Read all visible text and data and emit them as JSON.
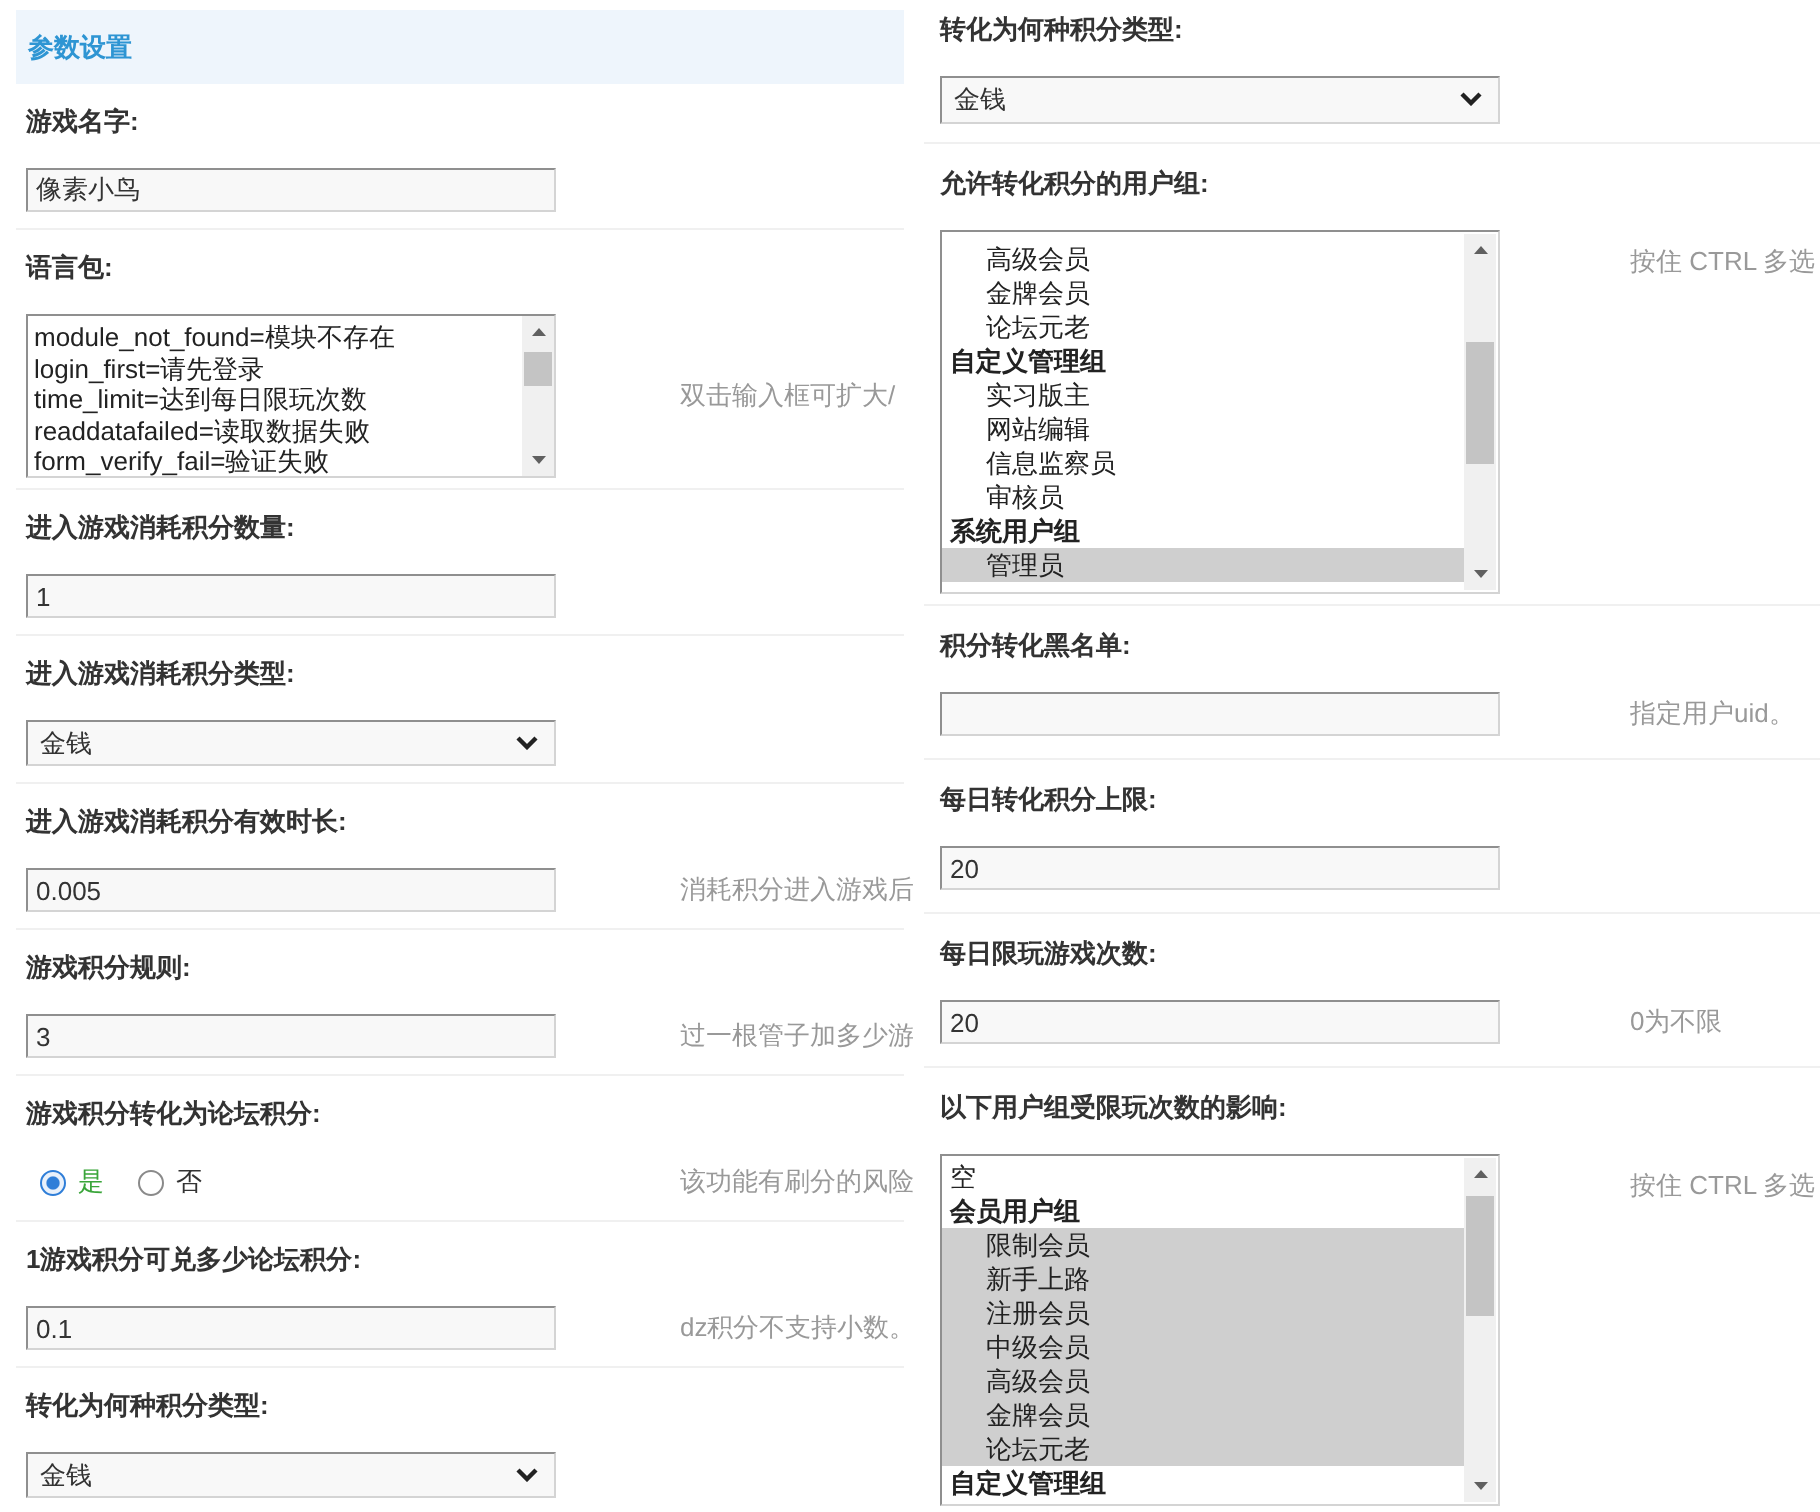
{
  "left_column": {
    "section_title": "参数设置",
    "settings": [
      {
        "kind": "text",
        "label": "游戏名字:",
        "value": "像素小鸟"
      },
      {
        "kind": "textarea",
        "label": "语言包:",
        "lines": [
          "module_not_found=模块不存在",
          "login_first=请先登录",
          "time_limit=达到每日限玩次数",
          "readdatafailed=读取数据失败",
          "form_verify_fail=验证失败"
        ],
        "hint": "双击输入框可扩大/"
      },
      {
        "kind": "text",
        "label": "进入游戏消耗积分数量:",
        "value": "1"
      },
      {
        "kind": "select",
        "label": "进入游戏消耗积分类型:",
        "value": "金钱"
      },
      {
        "kind": "text",
        "label": "进入游戏消耗积分有效时长:",
        "value": "0.005",
        "hint": "消耗积分进入游戏后"
      },
      {
        "kind": "text",
        "label": "游戏积分规则:",
        "value": "3",
        "hint": "过一根管子加多少游"
      },
      {
        "kind": "radio",
        "label": "游戏积分转化为论坛积分:",
        "options": [
          {
            "label": "是",
            "selected": true
          },
          {
            "label": "否",
            "selected": false
          }
        ],
        "hint": "该功能有刷分的风险"
      },
      {
        "kind": "text",
        "label": "1游戏积分可兑多少论坛积分:",
        "value": "0.1",
        "hint": "dz积分不支持小数。"
      },
      {
        "kind": "select",
        "label": "转化为何种积分类型:",
        "value": "金钱"
      }
    ]
  },
  "right_column": {
    "settings": [
      {
        "kind": "select",
        "label": "转化为何种积分类型:",
        "value": "金钱"
      },
      {
        "kind": "listbox",
        "label": "允许转化积分的用户组:",
        "items": [
          {
            "kind": "group",
            "children": [
              {
                "label": "高级会员",
                "selected": false
              },
              {
                "label": "金牌会员",
                "selected": false
              },
              {
                "label": "论坛元老",
                "selected": false
              }
            ]
          },
          {
            "kind": "group",
            "label": "自定义管理组",
            "children": [
              {
                "label": "实习版主",
                "selected": false
              },
              {
                "label": "网站编辑",
                "selected": false
              },
              {
                "label": "信息监察员",
                "selected": false
              },
              {
                "label": "审核员",
                "selected": false
              }
            ]
          },
          {
            "kind": "group",
            "label": "系统用户组",
            "children": [
              {
                "label": "管理员",
                "selected": true
              }
            ]
          }
        ],
        "hint": "按住 CTRL 多选"
      },
      {
        "kind": "text",
        "label": "积分转化黑名单:",
        "hint": "指定用户uid。"
      },
      {
        "kind": "text",
        "label": "每日转化积分上限:",
        "value": "20"
      },
      {
        "kind": "text",
        "label": "每日限玩游戏次数:",
        "value": "20",
        "hint": "0为不限"
      },
      {
        "kind": "listbox",
        "label": "以下用户组受限玩次数的影响:",
        "items": [
          {
            "kind": "option",
            "label": "空",
            "selected": false
          },
          {
            "kind": "group",
            "label": "会员用户组",
            "children": [
              {
                "label": "限制会员",
                "selected": true
              },
              {
                "label": "新手上路",
                "selected": true
              },
              {
                "label": "注册会员",
                "selected": true
              },
              {
                "label": "中级会员",
                "selected": true
              },
              {
                "label": "高级会员",
                "selected": true
              },
              {
                "label": "金牌会员",
                "selected": true
              },
              {
                "label": "论坛元老",
                "selected": true
              }
            ]
          },
          {
            "kind": "group",
            "label": "自定义管理组"
          }
        ],
        "hint": "按住 CTRL 多选"
      }
    ]
  }
}
